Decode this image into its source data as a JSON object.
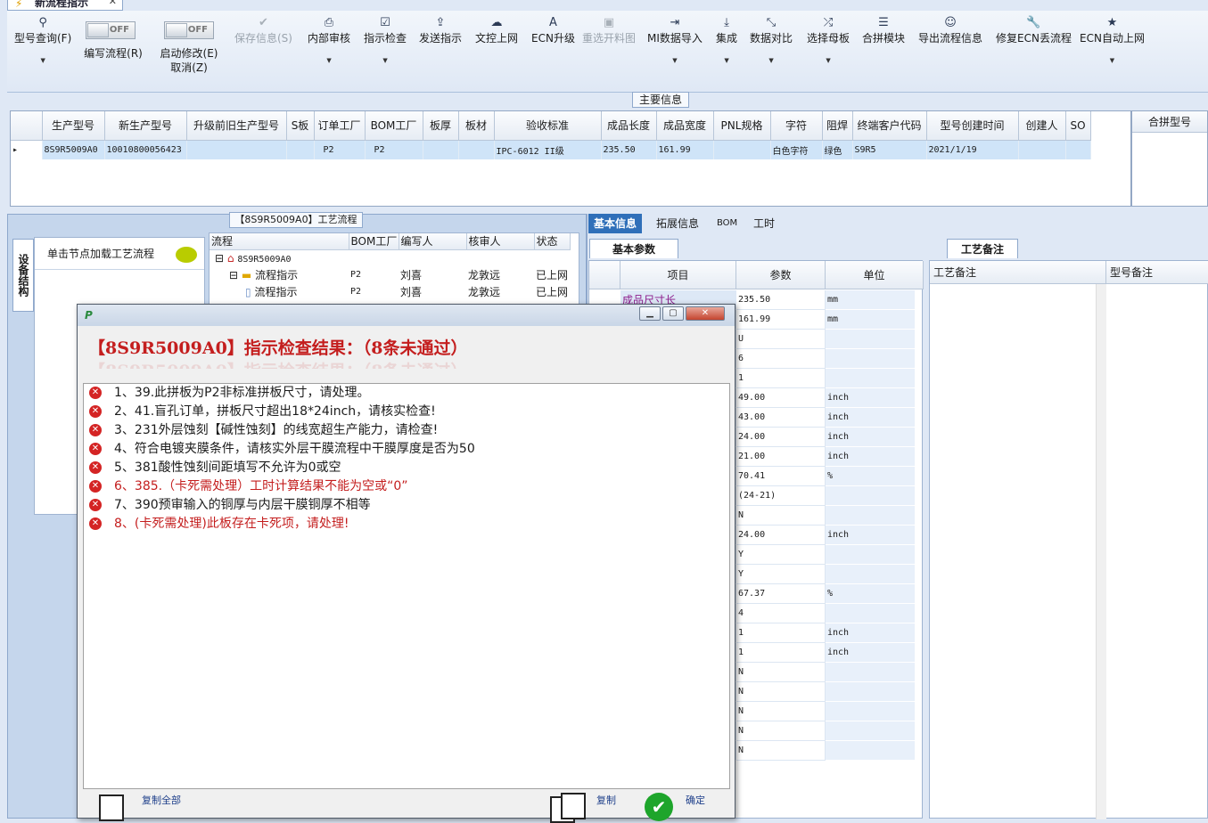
{
  "window_tab": {
    "title": "新流程指示"
  },
  "toolbar": {
    "items": [
      {
        "label": "型号查询(F)",
        "icon": "search-icon",
        "glyph": "⚲"
      },
      {
        "label": "保存信息(S)",
        "icon": "check-icon",
        "glyph": "✔"
      },
      {
        "label": "内部审核",
        "icon": "print-icon",
        "glyph": "⎙"
      },
      {
        "label": "指示检查",
        "icon": "checkbox-icon",
        "glyph": "☑"
      },
      {
        "label": "发送指示",
        "icon": "upload-icon",
        "glyph": "⇪"
      },
      {
        "label": "文控上网",
        "icon": "cloud-upload-icon",
        "glyph": "☁"
      },
      {
        "label": "ECN升级",
        "icon": "font-icon",
        "glyph": "A"
      },
      {
        "label": "重选开料图",
        "icon": "image-icon",
        "glyph": "▣"
      },
      {
        "label": "MI数据导入",
        "icon": "sign-in-icon",
        "glyph": "⇥"
      },
      {
        "label": "集成",
        "icon": "download-icon",
        "glyph": "⤓"
      },
      {
        "label": "数据对比",
        "icon": "compress-icon",
        "glyph": "⤡"
      },
      {
        "label": "选择母板",
        "icon": "shuffle-icon",
        "glyph": "⤮"
      },
      {
        "label": "合拼模块",
        "icon": "list-icon",
        "glyph": "☰"
      },
      {
        "label": "导出流程信息",
        "icon": "smile-icon",
        "glyph": "☺"
      },
      {
        "label": "修复ECN丢流程",
        "icon": "wrench-icon",
        "glyph": "🔧"
      },
      {
        "label": "ECN自动上网",
        "icon": "star-icon",
        "glyph": "★"
      }
    ],
    "toggles": [
      {
        "state": "OFF",
        "label": "编写流程(R)"
      },
      {
        "state": "OFF",
        "label": "启动修改(E)",
        "sublabel": "取消(Z)"
      }
    ]
  },
  "main_info": {
    "title": "主要信息",
    "columns": [
      "生产型号",
      "新生产型号",
      "升级前旧生产型号",
      "S板",
      "订单工厂",
      "BOM工厂",
      "板厚",
      "板材",
      "验收标准",
      "成品长度",
      "成品宽度",
      "PNL规格",
      "字符",
      "阻焊",
      "终端客户代码",
      "型号创建时间",
      "创建人",
      "SO"
    ],
    "row": [
      "8S9R5009A0",
      "10010800056423",
      "",
      "",
      "P2",
      "P2",
      "",
      "",
      "IPC-6012 II级",
      "235.50",
      "161.99",
      "",
      "白色字符",
      "绿色",
      "S9R5",
      "2021/1/19",
      "",
      ""
    ],
    "side_column": "合拼型号"
  },
  "left_panel": {
    "vertical_tab": "设备结构",
    "hint": "单击节点加载工艺流程"
  },
  "flow_panel": {
    "title": "【8S9R5009A0】工艺流程",
    "columns": [
      "流程",
      "BOM工厂",
      "编写人",
      "核审人",
      "状态"
    ],
    "rows": [
      {
        "name": "8S9R5009A0",
        "bom": "",
        "writer": "",
        "reviewer": "",
        "status": ""
      },
      {
        "name": "流程指示",
        "bom": "P2",
        "writer": "刘喜",
        "reviewer": "龙敦远",
        "status": "已上网"
      },
      {
        "name": "流程指示",
        "bom": "P2",
        "writer": "刘喜",
        "reviewer": "龙敦远",
        "status": "已上网"
      }
    ]
  },
  "right_tabs": [
    "基本信息",
    "拓展信息",
    "BOM",
    "工时"
  ],
  "basic_params": {
    "tab": "基本参数",
    "columns": [
      "项目",
      "参数",
      "单位"
    ],
    "rows": [
      {
        "item": "成品尺寸长",
        "value": "235.50",
        "unit": "mm"
      },
      {
        "item": "",
        "value": "161.99",
        "unit": "mm"
      },
      {
        "item": "",
        "value": "U",
        "unit": ""
      },
      {
        "item": "",
        "value": "6",
        "unit": ""
      },
      {
        "item": "",
        "value": "1",
        "unit": ""
      },
      {
        "item": "",
        "value": "49.00",
        "unit": "inch"
      },
      {
        "item": "",
        "value": "43.00",
        "unit": "inch"
      },
      {
        "item": "",
        "value": "24.00",
        "unit": "inch"
      },
      {
        "item": "",
        "value": "21.00",
        "unit": "inch"
      },
      {
        "item": "",
        "value": "70.41",
        "unit": "%"
      },
      {
        "item": "",
        "value": "(24-21)",
        "unit": ""
      },
      {
        "item": "",
        "value": "N",
        "unit": ""
      },
      {
        "item": "",
        "value": "24.00",
        "unit": "inch"
      },
      {
        "item": "",
        "value": "Y",
        "unit": ""
      },
      {
        "item": "",
        "value": "Y",
        "unit": ""
      },
      {
        "item": "",
        "value": "67.37",
        "unit": "%"
      },
      {
        "item": "",
        "value": "4",
        "unit": ""
      },
      {
        "item": "",
        "value": "1",
        "unit": "inch"
      },
      {
        "item": "",
        "value": "1",
        "unit": "inch"
      },
      {
        "item": "",
        "value": "N",
        "unit": ""
      },
      {
        "item": "",
        "value": "N",
        "unit": ""
      },
      {
        "item": "",
        "value": "N",
        "unit": ""
      },
      {
        "item": "",
        "value": "N",
        "unit": ""
      },
      {
        "item": "",
        "value": "N",
        "unit": ""
      }
    ]
  },
  "tech_notes": {
    "tab": "工艺备注",
    "col1": "工艺备注",
    "col2": "型号备注"
  },
  "dialog": {
    "heading": "【8S9R5009A0】指示检查结果：（8条未通过）",
    "messages": [
      {
        "text": "1、39.此拼板为P2非标准拼板尺寸，请处理。",
        "red": false
      },
      {
        "text": "2、41.盲孔订单，拼板尺寸超出18*24inch，请核实检查!",
        "red": false
      },
      {
        "text": "3、231外层蚀刻【碱性蚀刻】的线宽超生产能力，请检查!",
        "red": false
      },
      {
        "text": "4、符合电镀夹膜条件，请核实外层干膜流程中干膜厚度是否为50",
        "red": false
      },
      {
        "text": "5、381酸性蚀刻间距填写不允许为0或空",
        "red": false
      },
      {
        "text": "6、385.（卡死需处理）工时计算结果不能为空或“0”",
        "red": true
      },
      {
        "text": "7、390预审输入的铜厚与内层干膜铜厚不相等",
        "red": false
      },
      {
        "text": "8、(卡死需处理)此板存在卡死项，请处理!",
        "red": true
      }
    ],
    "buttons": {
      "copy_all": "复制全部",
      "copy": "复制",
      "ok": "确定"
    }
  },
  "colors": {
    "accent": "#2f6fb9",
    "error": "#c41e1e",
    "ok": "#1ea52b",
    "selected_row": "#cfe4f8"
  }
}
